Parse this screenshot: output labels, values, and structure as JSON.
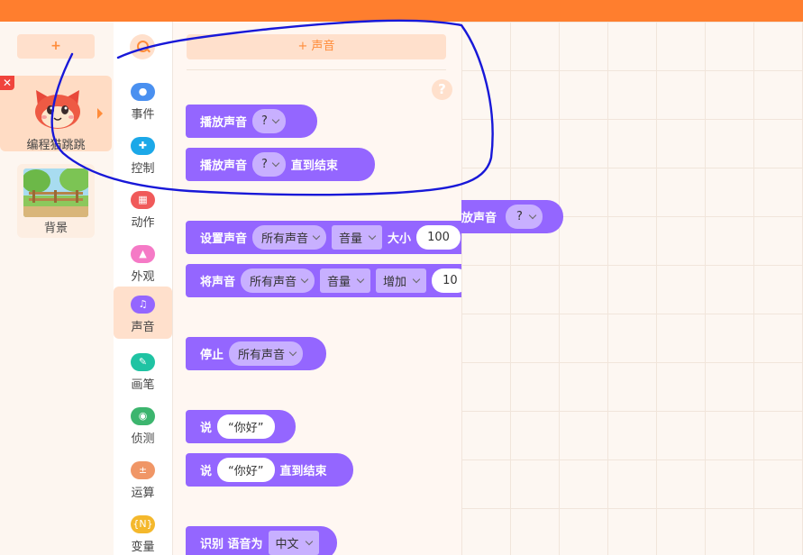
{
  "sprite_panel": {
    "add_label": "+",
    "sprite": {
      "name": "编程猫跳跳",
      "delete_label": "✕"
    },
    "background": {
      "name": "背景"
    }
  },
  "categories": [
    {
      "label": "事件",
      "color": "#4a90f0",
      "glyph": "●"
    },
    {
      "label": "控制",
      "color": "#1ca8e8",
      "glyph": "✚"
    },
    {
      "label": "动作",
      "color": "#f05a5a",
      "glyph": "▦"
    },
    {
      "label": "外观",
      "color": "#f57ac6",
      "glyph": "▲"
    },
    {
      "label": "声音",
      "color": "#9466ff",
      "glyph": "♫"
    },
    {
      "label": "画笔",
      "color": "#1fc3a3",
      "glyph": "✎"
    },
    {
      "label": "侦测",
      "color": "#3cb56e",
      "glyph": "◉"
    },
    {
      "label": "运算",
      "color": "#f09666",
      "glyph": "±"
    },
    {
      "label": "变量",
      "color": "#f4b82c",
      "glyph": "{N}"
    }
  ],
  "active_category": "声音",
  "palette": {
    "add_sound_label": "+ 声音",
    "help_label": "?",
    "blocks": {
      "play_sound": {
        "label": "播放声音",
        "value": "?"
      },
      "play_sound_until": {
        "label": "播放声音",
        "value": "?",
        "suffix": "直到结束"
      },
      "set_sound": {
        "label": "设置声音",
        "target": "所有声音",
        "property": "音量",
        "size_label": "大小",
        "size_value": "100"
      },
      "change_sound": {
        "label": "将声音",
        "target": "所有声音",
        "property": "音量",
        "op": "增加",
        "amount": "10"
      },
      "stop": {
        "label": "停止",
        "target": "所有声音"
      },
      "say": {
        "label": "说",
        "value": "“你好”"
      },
      "say_until": {
        "label": "说",
        "value": "“你好”",
        "suffix": "直到结束"
      },
      "recognize": {
        "label": "识别 语音为",
        "value": "中文"
      }
    }
  },
  "workspace": {
    "block": {
      "label": "放声音",
      "value": "?"
    }
  }
}
